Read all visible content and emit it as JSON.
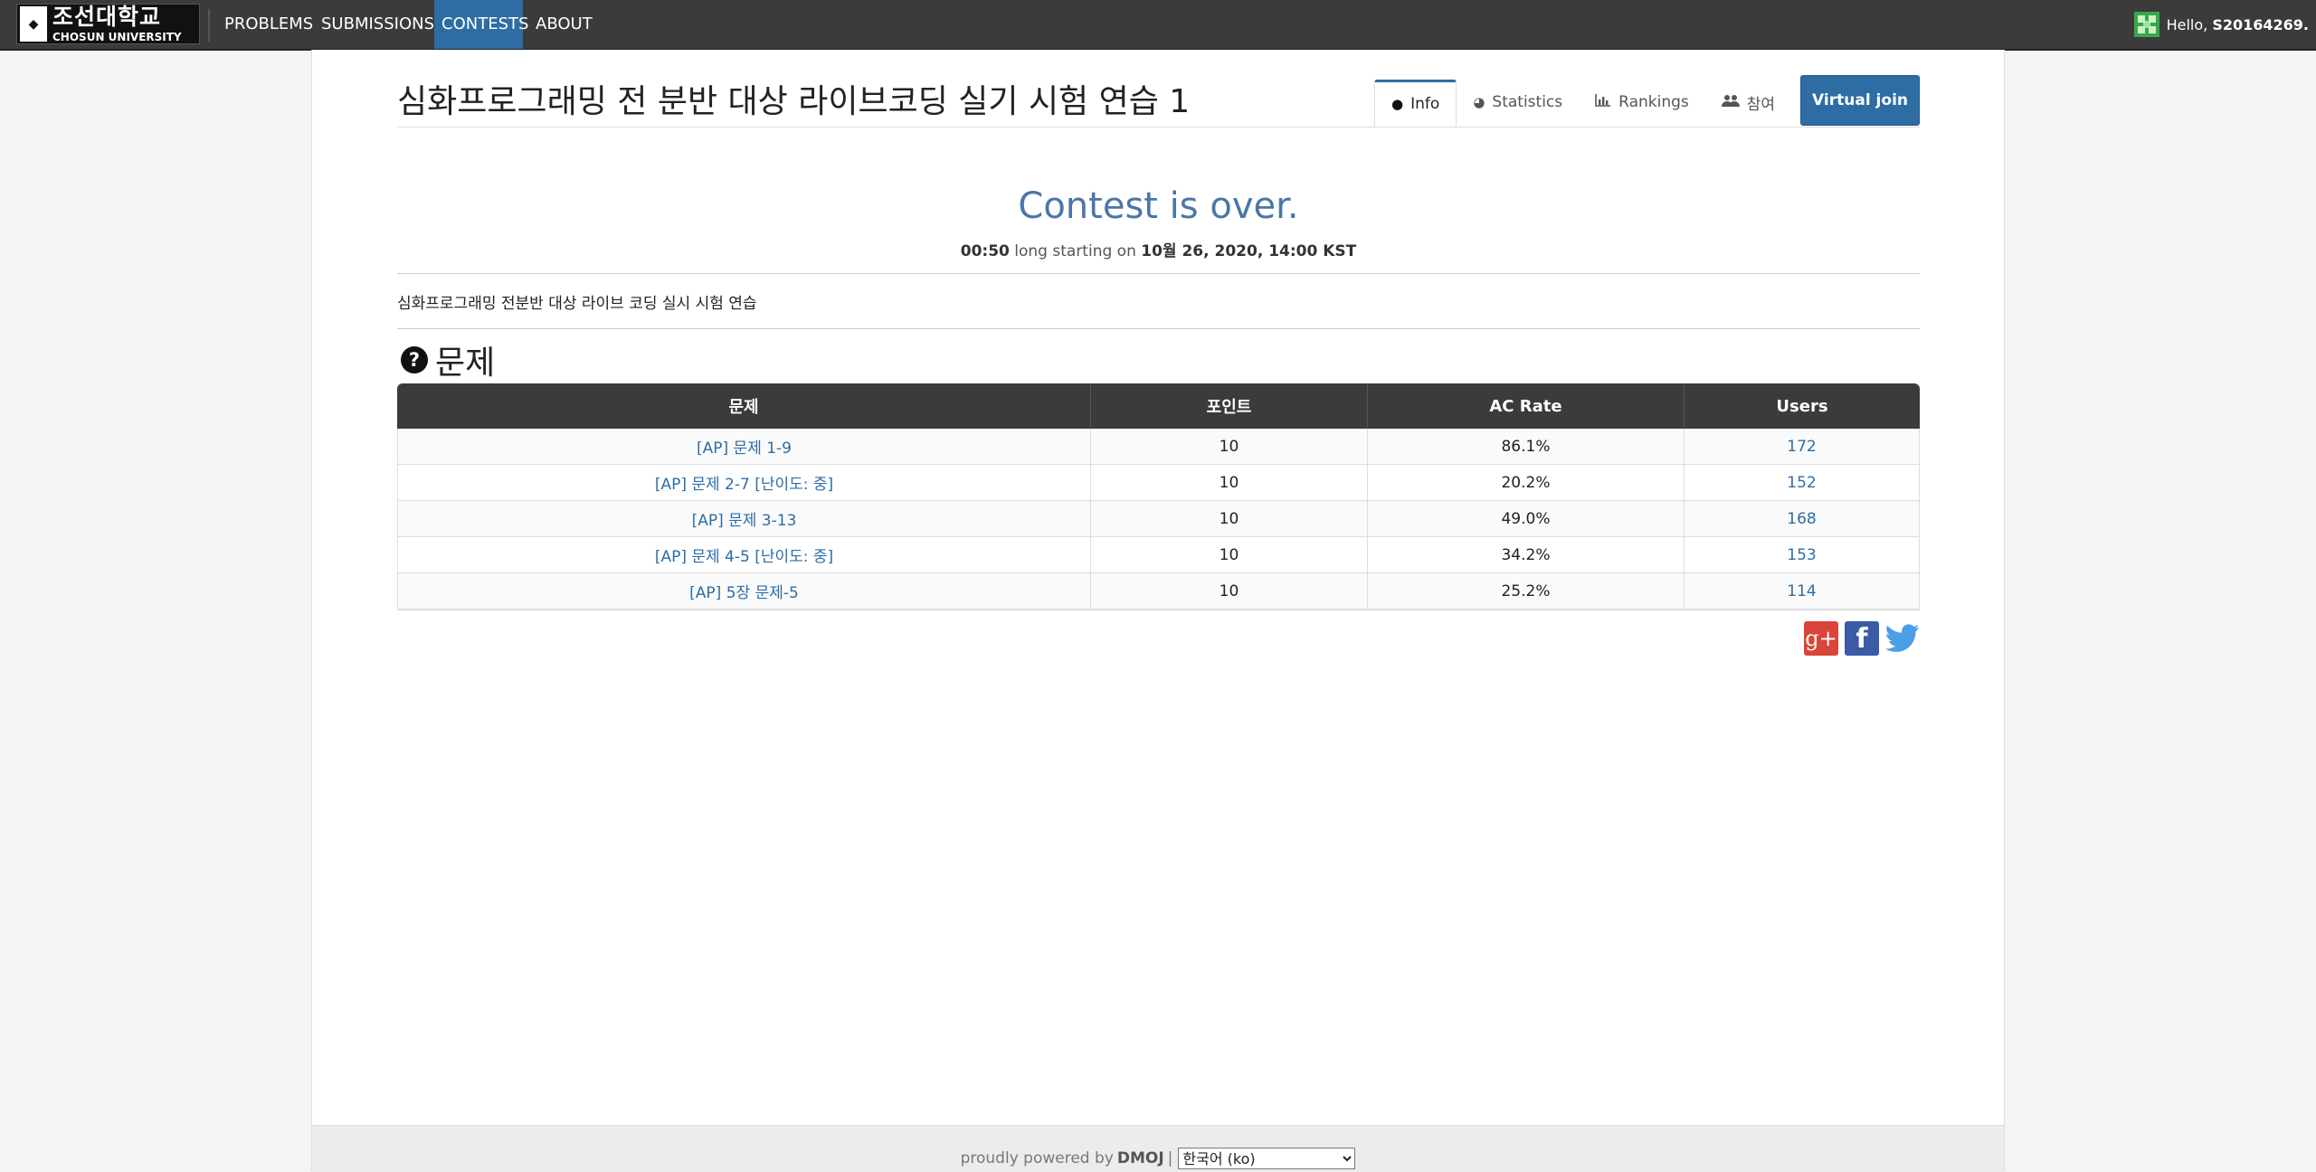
{
  "nav": {
    "logo_ko": "조선대학교",
    "logo_en": "CHOSUN UNIVERSITY",
    "items": [
      {
        "label": "PROBLEMS"
      },
      {
        "label": "SUBMISSIONS"
      },
      {
        "label": "CONTESTS",
        "active": true
      },
      {
        "label": "ABOUT"
      }
    ],
    "greeting": "Hello,",
    "username": "S20164269."
  },
  "contest": {
    "title": "심화프로그래밍 전 분반 대상 라이브코딩 실기 시험 연습 1",
    "tabs": [
      {
        "label": "Info",
        "icon": "info-circle-icon",
        "active": true
      },
      {
        "label": "Statistics",
        "icon": "pie-chart-icon"
      },
      {
        "label": "Rankings",
        "icon": "bar-chart-icon"
      },
      {
        "label": "참여",
        "icon": "users-icon"
      }
    ],
    "virtual_join": "Virtual join",
    "status": "Contest is over.",
    "duration": "00:50",
    "long_starting_on": "long starting on",
    "start_time": "10월 26, 2020, 14:00 KST",
    "description": "심화프로그래밍 전분반 대상 라이브 코딩 실시 시험 연습"
  },
  "problems": {
    "heading": "문제",
    "columns": [
      "문제",
      "포인트",
      "AC Rate",
      "Users"
    ],
    "rows": [
      {
        "name": "[AP] 문제 1-9",
        "points": "10",
        "ac_rate": "86.1%",
        "users": "172"
      },
      {
        "name": "[AP] 문제 2-7 [난이도: 중]",
        "points": "10",
        "ac_rate": "20.2%",
        "users": "152"
      },
      {
        "name": "[AP] 문제 3-13",
        "points": "10",
        "ac_rate": "49.0%",
        "users": "168"
      },
      {
        "name": "[AP] 문제 4-5 [난이도: 중]",
        "points": "10",
        "ac_rate": "34.2%",
        "users": "153"
      },
      {
        "name": "[AP] 5장 문제-5",
        "points": "10",
        "ac_rate": "25.2%",
        "users": "114"
      }
    ]
  },
  "share": {
    "icons": [
      "google-plus-icon",
      "facebook-icon",
      "twitter-icon"
    ],
    "gplus_glyph": "g+",
    "facebook_glyph": "f"
  },
  "footer": {
    "powered_by": "proudly powered by",
    "brand": "DMOJ",
    "separator": "|",
    "language": "한국어 (ko)"
  },
  "colors": {
    "navbar": "#3b3b3b",
    "accent": "#2e6da4",
    "status_text": "#4a76a8",
    "table_header": "#3b3b3b"
  }
}
